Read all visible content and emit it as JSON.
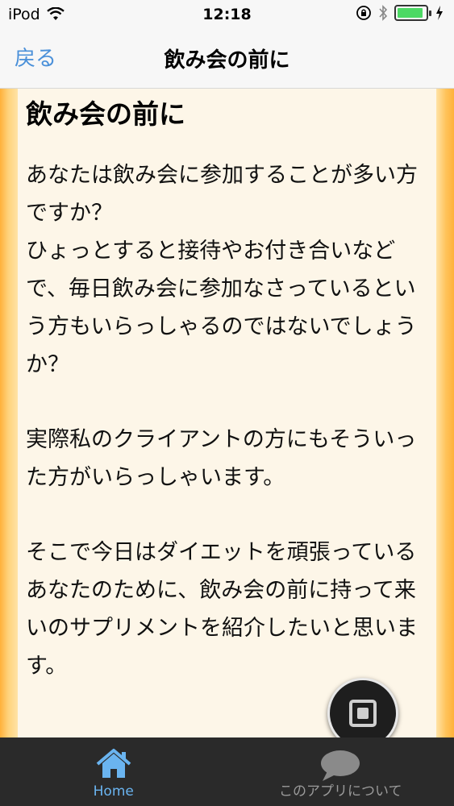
{
  "status_bar": {
    "device": "iPod",
    "time": "12:18",
    "battery_level": 0.9
  },
  "nav": {
    "back_label": "戻る",
    "title": "飲み会の前に"
  },
  "article": {
    "title": "飲み会の前に",
    "paragraphs": [
      "あなたは飲み会に参加することが多い方ですか？\nひょっとすると接待やお付き合いなどで、毎日飲み会に参加なさっているという方もいらっしゃるのではないでしょうか？",
      "実際私のクライアントの方にもそういった方がいらっしゃいます。",
      "そこで今日はダイエットを頑張っているあなたのために、飲み会の前に持って来いのサプリメントを紹介したいと思います。"
    ]
  },
  "tabs": {
    "home_label": "Home",
    "about_label": "このアプリについて",
    "active_color": "#6ab4f0",
    "inactive_color": "#9a9a9a"
  },
  "colors": {
    "accent": "#4a90d9",
    "border_orange": "#ffb13a",
    "panel_bg": "#fdf6e8"
  }
}
